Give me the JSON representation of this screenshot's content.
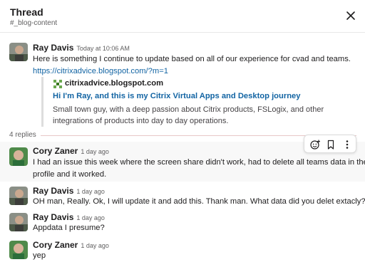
{
  "header": {
    "title": "Thread",
    "channel": "#_blog-content"
  },
  "parent": {
    "author": "Ray Davis",
    "time": "Today at 10:06 AM",
    "text": "Here is something I continue to update based on all of our experience for cvad and teams.",
    "link": "https://citrixadvice.blogspot.com/?m=1",
    "unfurl": {
      "site": "citrixadvice.blogspot.com",
      "title": "Hi I'm Ray, and this is my Citrix Virtual Apps and Desktop journey",
      "description_line1": "Small town guy, with a deep passion about Citrix products, FSLogix, and other",
      "description_line2": "integrations of products into day to day operations."
    }
  },
  "replies_count": "4 replies",
  "replies": [
    {
      "author": "Cory Zaner",
      "time": "1 day ago",
      "line1": "I had an issue this week where the screen share didn't work, had to delete all teams data in the",
      "line2": "profile and it worked."
    },
    {
      "author": "Ray Davis",
      "time": "1 day ago",
      "line1": "OH man, Really. Ok, I will update it and add this. Thank man. What data did you delet extacly?"
    },
    {
      "author": "Ray Davis",
      "time": "1 day ago",
      "line1": "Appdata I presume?"
    },
    {
      "author": "Cory Zaner",
      "time": "1 day ago",
      "line1": "yep"
    }
  ],
  "icons": {
    "close": "close-icon",
    "site": "blogger-site-icon",
    "react": "add-reaction-icon",
    "save": "bookmark-icon",
    "more": "more-actions-icon"
  }
}
